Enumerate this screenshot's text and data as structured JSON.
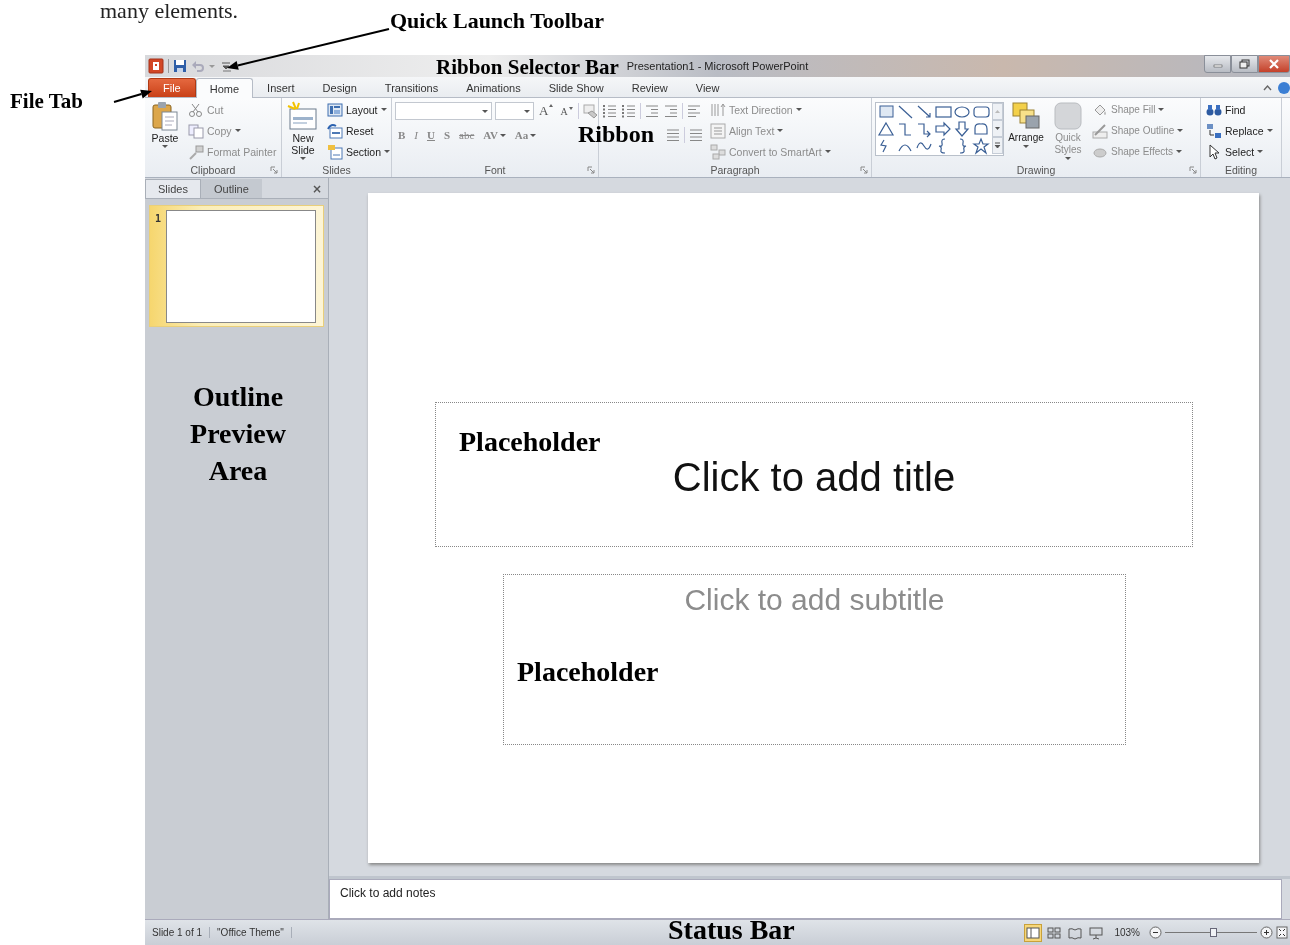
{
  "page_text": "many elements.",
  "annotations": {
    "quick_launch": "Quick Launch Toolbar",
    "file_tab": "File Tab",
    "ribbon_selector": "Ribbon Selector Bar",
    "ribbon": "Ribbon",
    "outline_area": "Outline Preview Area",
    "title_placeholder": "Placeholder",
    "subtitle_placeholder": "Placeholder",
    "status_bar": "Status Bar"
  },
  "window": {
    "title": "Presentation1  -  Microsoft PowerPoint"
  },
  "tabs": [
    {
      "label": "File",
      "kind": "file",
      "selected": false
    },
    {
      "label": "Home",
      "kind": "normal",
      "selected": true
    },
    {
      "label": "Insert",
      "kind": "normal",
      "selected": false
    },
    {
      "label": "Design",
      "kind": "normal",
      "selected": false
    },
    {
      "label": "Transitions",
      "kind": "normal",
      "selected": false
    },
    {
      "label": "Animations",
      "kind": "normal",
      "selected": false
    },
    {
      "label": "Slide Show",
      "kind": "normal",
      "selected": false
    },
    {
      "label": "Review",
      "kind": "normal",
      "selected": false
    },
    {
      "label": "View",
      "kind": "normal",
      "selected": false
    }
  ],
  "ribbon": {
    "groups": [
      {
        "kind": "clipboard",
        "name": "Clipboard",
        "launcher": true,
        "commands": [
          {
            "label": "Paste",
            "kind": "large",
            "disabled": false,
            "dropdown": true
          },
          {
            "label": "Cut",
            "kind": "small",
            "disabled": true,
            "dropdown": false
          },
          {
            "label": "Copy",
            "kind": "small",
            "disabled": true,
            "dropdown": true
          },
          {
            "label": "Format Painter",
            "kind": "small",
            "disabled": true,
            "dropdown": false
          }
        ]
      },
      {
        "kind": "slides",
        "name": "Slides",
        "launcher": false,
        "commands": [
          {
            "label": "New Slide",
            "kind": "large",
            "disabled": false,
            "dropdown": true
          },
          {
            "label": "Layout",
            "kind": "small",
            "disabled": false,
            "dropdown": true
          },
          {
            "label": "Reset",
            "kind": "small",
            "disabled": false,
            "dropdown": false
          },
          {
            "label": "Section",
            "kind": "small",
            "disabled": false,
            "dropdown": true
          }
        ]
      },
      {
        "kind": "font",
        "name": "Font",
        "launcher": true,
        "disabled": true,
        "size_buttons": [
          {
            "label": "A",
            "grow": true
          },
          {
            "label": "A",
            "grow": false
          }
        ],
        "format_buttons": [
          {
            "label": "B",
            "dropdown": false
          },
          {
            "label": "I",
            "dropdown": false
          },
          {
            "label": "U",
            "dropdown": false
          },
          {
            "label": "S",
            "dropdown": false
          },
          {
            "label": "abc",
            "dropdown": false
          },
          {
            "label": "AV",
            "dropdown": true
          },
          {
            "label": "Aa",
            "dropdown": true
          }
        ]
      },
      {
        "kind": "paragraph",
        "name": "Paragraph",
        "launcher": true,
        "commands": [
          {
            "label": "Text Direction",
            "kind": "small",
            "disabled": true,
            "dropdown": true
          },
          {
            "label": "Align Text",
            "kind": "small",
            "disabled": true,
            "dropdown": true
          },
          {
            "label": "Convert to SmartArt",
            "kind": "small",
            "disabled": true,
            "dropdown": true
          }
        ]
      },
      {
        "kind": "drawing",
        "name": "Drawing",
        "launcher": true,
        "commands": [
          {
            "label": "Arrange",
            "kind": "large",
            "disabled": false,
            "dropdown": true
          },
          {
            "label": "Quick Styles",
            "kind": "large",
            "disabled": true,
            "dropdown": true
          },
          {
            "label": "Shape Fill",
            "kind": "small",
            "disabled": true,
            "dropdown": true
          },
          {
            "label": "Shape Outline",
            "kind": "small",
            "disabled": true,
            "dropdown": true
          },
          {
            "label": "Shape Effects",
            "kind": "small",
            "disabled": true,
            "dropdown": true
          }
        ]
      },
      {
        "kind": "editing",
        "name": "Editing",
        "launcher": false,
        "commands": [
          {
            "label": "Find",
            "kind": "small",
            "disabled": false,
            "dropdown": false
          },
          {
            "label": "Replace",
            "kind": "small",
            "disabled": false,
            "dropdown": true
          },
          {
            "label": "Select",
            "kind": "small",
            "disabled": false,
            "dropdown": true
          }
        ]
      }
    ]
  },
  "slide_pane": {
    "tabs": [
      {
        "label": "Slides",
        "selected": true
      },
      {
        "label": "Outline",
        "selected": false
      }
    ],
    "close": "×",
    "thumbnails": [
      {
        "number": "1",
        "selected": true
      }
    ]
  },
  "slide": {
    "title_placeholder": "Click to add title",
    "subtitle_placeholder": "Click to add subtitle"
  },
  "notes": {
    "placeholder": "Click to add notes"
  },
  "status_bar": {
    "slide": "Slide 1 of 1",
    "theme": "\"Office Theme\"",
    "views": [
      {
        "kind": "normal",
        "selected": true
      },
      {
        "kind": "sorter",
        "selected": false
      },
      {
        "kind": "reading",
        "selected": false
      },
      {
        "kind": "slideshow",
        "selected": false
      }
    ],
    "zoom": "103%",
    "zoom_slider": {
      "level": 0.52
    }
  }
}
